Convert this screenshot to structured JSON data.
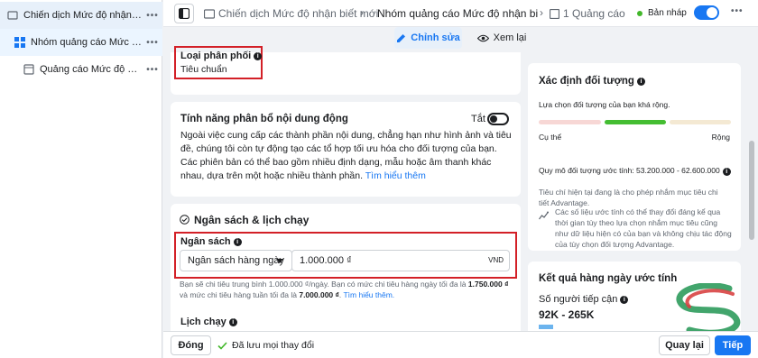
{
  "sidebar": {
    "items": [
      {
        "label": "Chiến dịch Mức độ nhận biết mới",
        "icon": "campaign-folder-icon"
      },
      {
        "label": "Nhóm quảng cáo Mức độ nhận biết mới",
        "icon": "adset-grid-icon"
      },
      {
        "label": "Quảng cáo Mức độ nhận biết mới",
        "icon": "ad-page-icon"
      }
    ],
    "more_label": "•••"
  },
  "topbar": {
    "crumb_campaign": "Chiến dịch Mức độ nhận biết mới",
    "crumb_adset": "Nhóm quảng cáo Mức độ nhận biết",
    "crumb_ads": "1 Quảng cáo",
    "separator": "›",
    "draft_label": "Bản nháp",
    "more_label": "•••"
  },
  "mode_tabs": {
    "edit": "Chỉnh sửa",
    "view": "Xem lại"
  },
  "delivery": {
    "label": "Loại phân phối",
    "value": "Tiêu chuẩn"
  },
  "dynamic": {
    "title": "Tính năng phân bổ nội dung động",
    "toggle_label": "Tắt",
    "description": "Ngoài việc cung cấp các thành phần nội dung, chẳng hạn như hình ảnh và tiêu đề, chúng tôi còn tự động tạo các tổ hợp tối ưu hóa cho đối tượng của bạn. Các phiên bản có thể bao gồm nhiều định dạng, mẫu hoặc âm thanh khác nhau, dựa trên một hoặc nhiều thành phần.",
    "link": "Tìm hiểu thêm"
  },
  "budget_schedule": {
    "title": "Ngân sách & lịch chạy",
    "budget_label": "Ngân sách",
    "budget_type": "Ngân sách hàng ngày",
    "budget_value": "1.000.000 ₫",
    "currency": "VND",
    "note_part1": "Bạn sẽ chi tiêu trung bình 1.000.000 ₫/ngày. Bạn có mức chi tiêu hàng ngày tối đa là",
    "note_max_daily": "1.750.000 ₫",
    "note_part2": "và mức chi tiêu hàng tuần tối đa là",
    "note_max_weekly": "7.000.000 ₫",
    "note_link": "Tìm hiểu thêm.",
    "schedule_label": "Lịch chạy"
  },
  "audience": {
    "title": "Xác định đối tượng",
    "subtitle": "Lựa chọn đối tượng của bạn khá rộng.",
    "left_label": "Cụ thể",
    "right_label": "Rộng",
    "size_label": "Quy mô đối tượng ước tính: 53.200.000 - 62.600.000",
    "criteria_note": "Tiêu chí hiện tại đang là cho phép nhắm mục tiêu chi tiết Advantage.",
    "variance_note": "Các số liệu ước tính có thể thay đổi đáng kể qua thời gian tùy theo lựa chọn nhắm mục tiêu cũng như dữ liệu hiện có của bạn và không chịu tác động của tùy chọn đối tượng Advantage."
  },
  "daily_results": {
    "title": "Kết quả hàng ngày ước tính",
    "reach_label": "Số người tiếp cận",
    "reach_value": "92K - 265K"
  },
  "bottombar": {
    "close": "Đóng",
    "saved": "Đã lưu mọi thay đổi",
    "back": "Quay lại",
    "next": "Tiếp"
  },
  "colors": {
    "accent": "#1877f2",
    "highlight": "#d32027",
    "success": "#42b72a"
  }
}
